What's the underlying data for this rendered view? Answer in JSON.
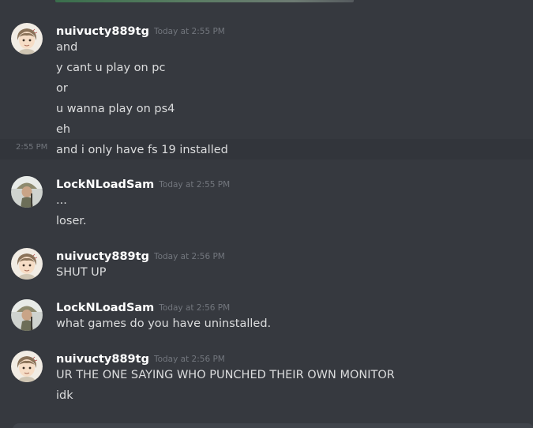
{
  "colors": {
    "background": "#36393f",
    "username": "#ffffff",
    "message_text": "#dcddde",
    "timestamp": "#72767d",
    "hover_row": "#32353b"
  },
  "messages": [
    {
      "author": "nuivucty889tg",
      "timestamp": "Today at 2:55 PM",
      "avatar_icon": "anime-boy-avatar-icon",
      "lines": [
        "and",
        "y cant u play on pc",
        "or",
        "u wanna play on ps4",
        "eh",
        "and i only have fs 19 installed"
      ],
      "hover_line_time": "2:55 PM"
    },
    {
      "author": "LockNLoadSam",
      "timestamp": "Today at 2:55 PM",
      "avatar_icon": "soldier-avatar-icon",
      "lines": [
        "...",
        "loser."
      ]
    },
    {
      "author": "nuivucty889tg",
      "timestamp": "Today at 2:56 PM",
      "avatar_icon": "anime-boy-avatar-icon",
      "lines": [
        "SHUT UP"
      ]
    },
    {
      "author": "LockNLoadSam",
      "timestamp": "Today at 2:56 PM",
      "avatar_icon": "soldier-avatar-icon",
      "lines": [
        "what games do you have uninstalled."
      ]
    },
    {
      "author": "nuivucty889tg",
      "timestamp": "Today at 2:56 PM",
      "avatar_icon": "anime-boy-avatar-icon",
      "lines": [
        "UR THE ONE SAYING WHO PUNCHED THEIR OWN MONITOR",
        "idk"
      ]
    }
  ]
}
